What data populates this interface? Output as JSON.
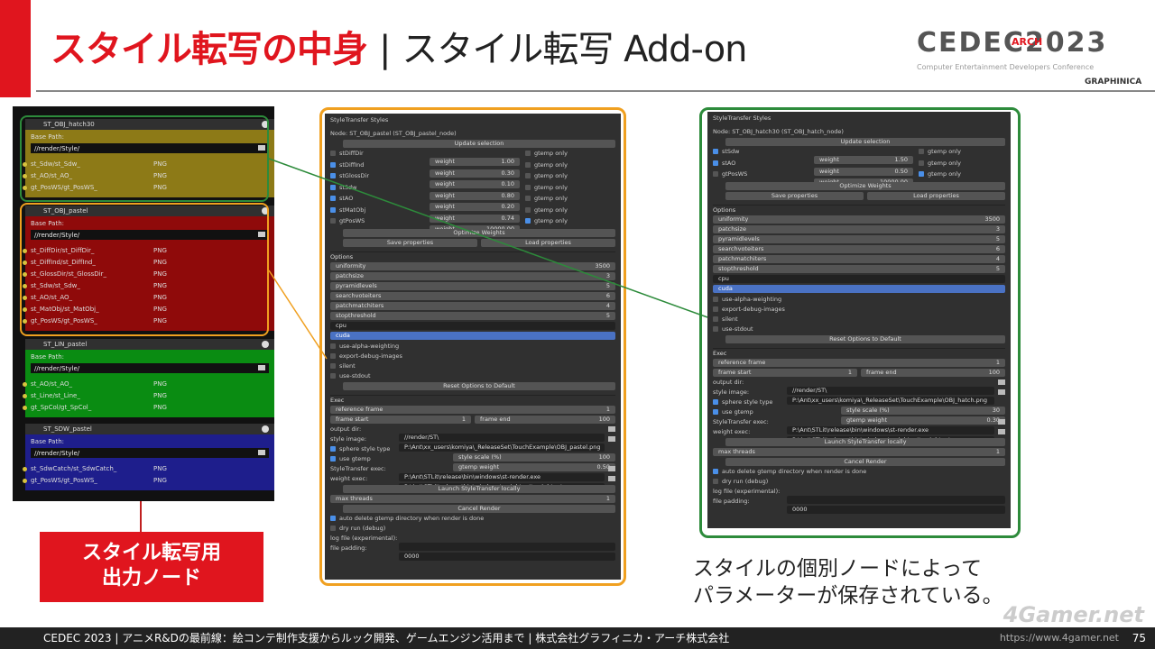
{
  "slide": {
    "title_red": "スタイル転写の中身",
    "title_sep": "|",
    "title_rest": "スタイル転写 Add-on",
    "logo": "CEDEC2023",
    "logo_arch": "ARCH",
    "logo_sub": "Computer Entertainment Developers Conference",
    "logo_graphinica": "GRAPHINICA",
    "red_label_line1": "スタイル転写用",
    "red_label_line2": "出力ノード",
    "caption_line1": "スタイルの個別ノードによって",
    "caption_line2": "パラメーターが保存されている。",
    "footer": "CEDEC 2023 | アニメR&Dの最前線：絵コンテ制作支援からルック開発、ゲームエンジン活用まで | 株式会社グラフィニカ・アーチ株式会社",
    "page": "75",
    "watermark": "https://www.4gamer.net",
    "watermark2": "4Gamer.net"
  },
  "nodes": [
    {
      "title": "ST_OBJ_hatch30",
      "base_label": "Base Path:",
      "path": "//render/Style/",
      "rows": [
        [
          "st_Sdw/st_Sdw_",
          "PNG"
        ],
        [
          "st_AO/st_AO_",
          "PNG"
        ],
        [
          "gt_PosWS/gt_PosWS_",
          "PNG"
        ]
      ]
    },
    {
      "title": "ST_OBJ_pastel",
      "base_label": "Base Path:",
      "path": "//render/Style/",
      "rows": [
        [
          "st_DiffDir/st_DiffDir_",
          "PNG"
        ],
        [
          "st_DiffInd/st_DiffInd_",
          "PNG"
        ],
        [
          "st_GlossDir/st_GlossDir_",
          "PNG"
        ],
        [
          "st_Sdw/st_Sdw_",
          "PNG"
        ],
        [
          "st_AO/st_AO_",
          "PNG"
        ],
        [
          "st_MatObj/st_MatObj_",
          "PNG"
        ],
        [
          "gt_PosWS/gt_PosWS_",
          "PNG"
        ]
      ]
    },
    {
      "title": "ST_LIN_pastel",
      "base_label": "Base Path:",
      "path": "//render/Style/",
      "rows": [
        [
          "st_AO/st_AO_",
          "PNG"
        ],
        [
          "st_Line/st_Line_",
          "PNG"
        ],
        [
          "gt_SpCol/gt_SpCol_",
          "PNG"
        ]
      ]
    },
    {
      "title": "ST_SDW_pastel",
      "base_label": "Base Path:",
      "path": "//render/Style/",
      "rows": [
        [
          "st_SdwCatch/st_SdwCatch_",
          "PNG"
        ],
        [
          "gt_PosWS/gt_PosWS_",
          "PNG"
        ]
      ]
    }
  ],
  "panel1": {
    "header": "StyleTransfer Styles",
    "node": "Node: ST_OBJ_pastel (ST_OBJ_pastel_node)",
    "update": "Update selection",
    "styles": [
      {
        "name": "stDiffDir",
        "on": false,
        "w": "1.00",
        "gt": "gtemp only",
        "gton": false
      },
      {
        "name": "stDiffInd",
        "on": true,
        "w": "0.30",
        "gt": "gtemp only",
        "gton": false
      },
      {
        "name": "stGlossDir",
        "on": true,
        "w": "0.10",
        "gt": "gtemp only",
        "gton": false
      },
      {
        "name": "stSdw",
        "on": true,
        "w": "0.80",
        "gt": "gtemp only",
        "gton": false
      },
      {
        "name": "stAO",
        "on": true,
        "w": "0.20",
        "gt": "gtemp only",
        "gton": false
      },
      {
        "name": "stMatObj",
        "on": true,
        "w": "0.74",
        "gt": "gtemp only",
        "gton": false
      },
      {
        "name": "gtPosWS",
        "on": false,
        "w": "10000.00",
        "gt": "gtemp only",
        "gton": true
      }
    ],
    "weight_label": "weight",
    "optimize": "Optimize Weights",
    "save": "Save properties",
    "load": "Load properties",
    "options_header": "Options",
    "options": [
      [
        "uniformity",
        "3500"
      ],
      [
        "patchsize",
        "3"
      ],
      [
        "pyramidlevels",
        "5"
      ],
      [
        "searchvoteiters",
        "6"
      ],
      [
        "patchmatchiters",
        "4"
      ],
      [
        "stopthreshold",
        "5"
      ]
    ],
    "cpu": "cpu",
    "cuda": "cuda",
    "checks": [
      "use-alpha-weighting",
      "export-debug-images",
      "silent",
      "use-stdout"
    ],
    "reset": "Reset Options to Default",
    "exec_header": "Exec",
    "ref_frame": "reference frame",
    "ref_val": "1",
    "frame_start": "frame start",
    "fs_val": "1",
    "frame_end": "frame end",
    "fe_val": "100",
    "output_dir": "output dir:",
    "output_val": "//render/ST\\",
    "style_image": "style image:",
    "style_val": "P:\\Ant\\xx_users\\komiya\\_ReleaseSet\\TouchExample\\OBJ_pastel.png",
    "sphere": "sphere style type",
    "style_scale": "style scale (%)",
    "scale_val": "100",
    "use_gtemp": "use gtemp",
    "gtemp_weight": "gtemp weight",
    "gtemp_val": "0.50",
    "st_exec": "StyleTransfer exec:",
    "st_exec_val": "P:\\Ant\\STLit\\release\\bin\\windows\\st-render.exe",
    "w_exec": "weight exec:",
    "w_exec_val": "P:\\Ant\\STLit\\release\\bin\\windows\\weightopt\\weightopt.exe",
    "launch": "Launch StyleTransfer locally",
    "max_threads": "max threads",
    "mt_val": "1",
    "cancel": "Cancel Render",
    "auto_delete": "auto delete gtemp directory when render is done",
    "dry_run": "dry run (debug)",
    "log_file": "log file (experimental):",
    "file_padding": "file padding:",
    "padding_val": "0000"
  },
  "panel2": {
    "header": "StyleTransfer Styles",
    "node": "Node: ST_OBJ_hatch30 (ST_OBJ_hatch_node)",
    "update": "Update selection",
    "styles": [
      {
        "name": "stSdw",
        "on": true,
        "w": "1.50",
        "gt": "gtemp only",
        "gton": false
      },
      {
        "name": "stAO",
        "on": true,
        "w": "0.50",
        "gt": "gtemp only",
        "gton": false
      },
      {
        "name": "gtPosWS",
        "on": false,
        "w": "10000.00",
        "gt": "gtemp only",
        "gton": true
      }
    ],
    "weight_label": "weight",
    "optimize": "Optimize Weights",
    "save": "Save properties",
    "load": "Load properties",
    "options_header": "Options",
    "options": [
      [
        "uniformity",
        "3500"
      ],
      [
        "patchsize",
        "3"
      ],
      [
        "pyramidlevels",
        "5"
      ],
      [
        "searchvoteiters",
        "6"
      ],
      [
        "patchmatchiters",
        "4"
      ],
      [
        "stopthreshold",
        "5"
      ]
    ],
    "cpu": "cpu",
    "cuda": "cuda",
    "checks": [
      "use-alpha-weighting",
      "export-debug-images",
      "silent",
      "use-stdout"
    ],
    "reset": "Reset Options to Default",
    "exec_header": "Exec",
    "ref_frame": "reference frame",
    "ref_val": "1",
    "frame_start": "frame start",
    "fs_val": "1",
    "frame_end": "frame end",
    "fe_val": "100",
    "output_dir": "output dir:",
    "output_val": "//render/ST\\",
    "style_image": "style image:",
    "style_val": "P:\\Ant\\xx_users\\komiya\\_ReleaseSet\\TouchExample\\OBJ_hatch.png",
    "sphere": "sphere style type",
    "style_scale": "style scale (%)",
    "scale_val": "30",
    "use_gtemp": "use gtemp",
    "gtemp_weight": "gtemp weight",
    "gtemp_val": "0.30",
    "st_exec": "StyleTransfer exec:",
    "st_exec_val": "P:\\Ant\\STLit\\release\\bin\\windows\\st-render.exe",
    "w_exec": "weight exec:",
    "w_exec_val": "P:\\Ant\\STLit\\release\\bin\\windows\\weightopt\\weightopt.exe",
    "launch": "Launch StyleTransfer locally",
    "max_threads": "max threads",
    "mt_val": "1",
    "cancel": "Cancel Render",
    "auto_delete": "auto delete gtemp directory when render is done",
    "dry_run": "dry run (debug)",
    "log_file": "log file (experimental):",
    "file_padding": "file padding:",
    "padding_val": "0000"
  }
}
